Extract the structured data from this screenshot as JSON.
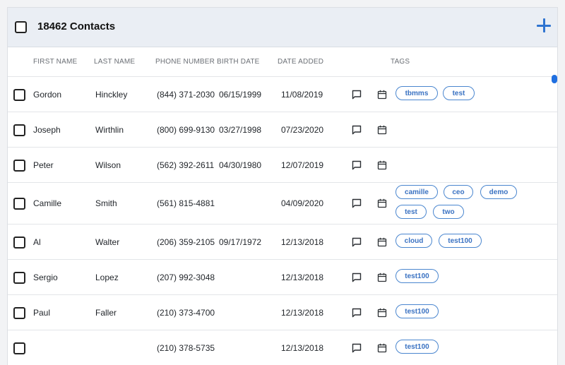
{
  "header": {
    "title": "18462 Contacts"
  },
  "columns": {
    "first_name": "FIRST NAME",
    "last_name": "LAST NAME",
    "phone": "PHONE NUMBER",
    "birth": "BIRTH DATE",
    "added": "DATE ADDED",
    "tags": "TAGS"
  },
  "rows": [
    {
      "first": "Gordon",
      "last": "Hinckley",
      "phone": "(844) 371-2030",
      "birth": "06/15/1999",
      "added": "11/08/2019",
      "tags": [
        "tbmms",
        "test"
      ]
    },
    {
      "first": "Joseph",
      "last": "Wirthlin",
      "phone": "(800) 699-9130",
      "birth": "03/27/1998",
      "added": "07/23/2020",
      "tags": []
    },
    {
      "first": "Peter",
      "last": "Wilson",
      "phone": "(562) 392-2611",
      "birth": "04/30/1980",
      "added": "12/07/2019",
      "tags": []
    },
    {
      "first": "Camille",
      "last": "Smith",
      "phone": "(561) 815-4881",
      "birth": "",
      "added": "04/09/2020",
      "tags": [
        "camille",
        "ceo",
        "demo",
        "test",
        "two"
      ]
    },
    {
      "first": "Al",
      "last": "Walter",
      "phone": "(206) 359-2105",
      "birth": "09/17/1972",
      "added": "12/13/2018",
      "tags": [
        "cloud",
        "test100"
      ]
    },
    {
      "first": "Sergio",
      "last": "Lopez",
      "phone": "(207) 992-3048",
      "birth": "",
      "added": "12/13/2018",
      "tags": [
        "test100"
      ]
    },
    {
      "first": "Paul",
      "last": "Faller",
      "phone": "(210) 373-4700",
      "birth": "",
      "added": "12/13/2018",
      "tags": [
        "test100"
      ]
    },
    {
      "first": "",
      "last": "",
      "phone": "(210) 378-5735",
      "birth": "",
      "added": "12/13/2018",
      "tags": [
        "test100"
      ]
    }
  ],
  "icons": {
    "message": "message-icon",
    "calendar": "calendar-icon",
    "add": "plus-icon"
  },
  "colors": {
    "accent": "#2f74d0",
    "tag_border": "#4a86cf",
    "header_bg": "#eaeef4",
    "scroll_thumb": "#1f6fe0"
  }
}
